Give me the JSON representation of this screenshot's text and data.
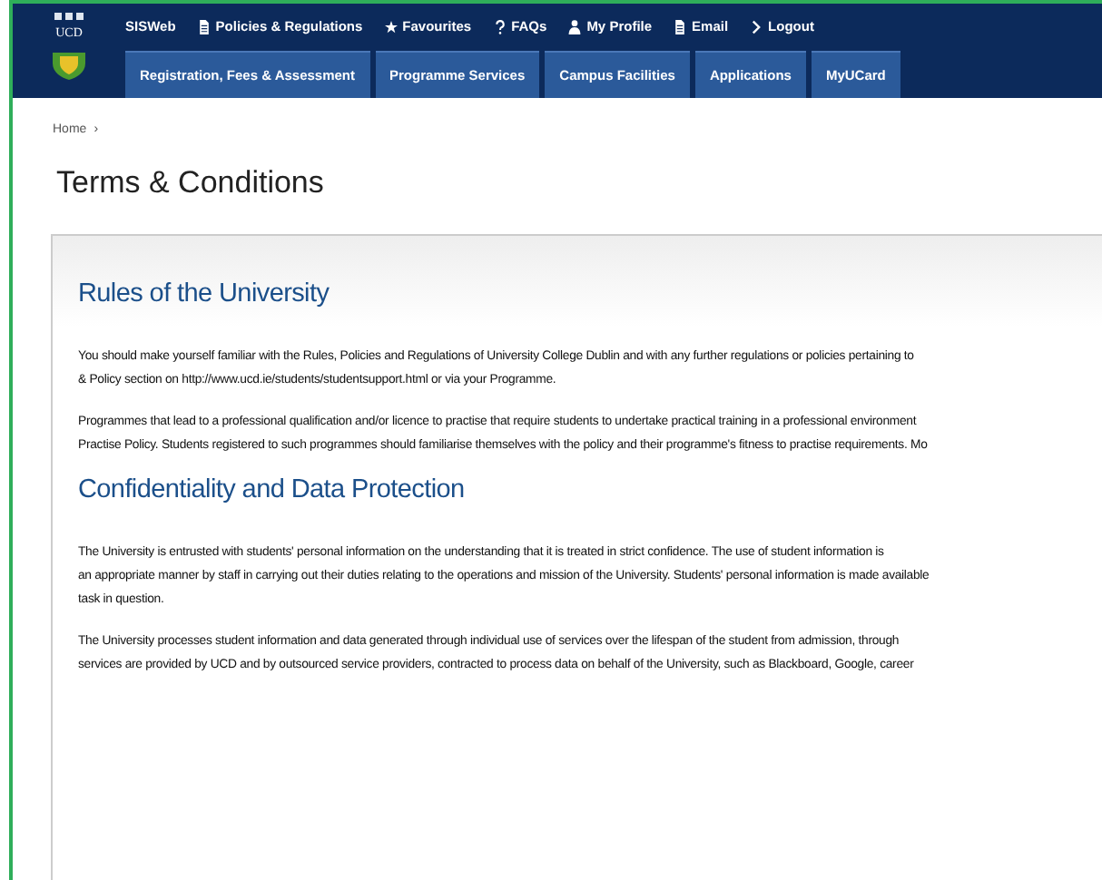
{
  "header": {
    "logo_text": "UCD",
    "top_links": [
      {
        "label": "SISWeb",
        "kind": "plain"
      },
      {
        "label": "Policies & Regulations",
        "kind": "document"
      },
      {
        "label": "Favourites",
        "kind": "star"
      },
      {
        "label": "FAQs",
        "kind": "question"
      },
      {
        "label": "My Profile",
        "kind": "person"
      },
      {
        "label": "Email",
        "kind": "document"
      },
      {
        "label": "Logout",
        "kind": "chevron"
      }
    ],
    "tabs": [
      {
        "label": "Registration, Fees & Assessment",
        "selected": false
      },
      {
        "label": "Programme Services",
        "selected": false
      },
      {
        "label": "Campus Facilities",
        "selected": false
      },
      {
        "label": "Applications",
        "selected": false
      },
      {
        "label": "MyUCard",
        "selected": false
      }
    ]
  },
  "breadcrumb": [
    {
      "label": "Home",
      "separator": "›"
    }
  ],
  "page_title": "Terms & Conditions",
  "sections": [
    {
      "heading": "Rules of the University",
      "paragraphs": [
        [
          "You should make yourself familiar with the Rules, Policies and Regulations of University College Dublin and with any further regulations or policies pertaining to",
          "& Policy section on http://www.ucd.ie/students/studentsupport.html or via your Programme."
        ],
        [
          "Programmes that lead to a professional qualification and/or licence to practise that require students to undertake practical training in a professional environment",
          "Practise Policy. Students registered to such programmes should familiarise themselves with the policy and their programme's fitness to practise requirements. Mo"
        ]
      ]
    },
    {
      "heading": "Confidentiality and Data Protection",
      "paragraphs": [
        [
          "The University is entrusted with students' personal information on the understanding that it is treated in strict confidence. The use of student information is",
          "an appropriate manner by staff in carrying out their duties relating to the operations and mission of the University. Students' personal information is made available",
          "task in question."
        ],
        [
          "The University processes student information and data generated through individual use of services over the lifespan of the student from admission, through",
          "services are provided by UCD and by outsourced service providers, contracted to process data on behalf of the University, such as Blackboard, Google, career"
        ]
      ]
    }
  ]
}
